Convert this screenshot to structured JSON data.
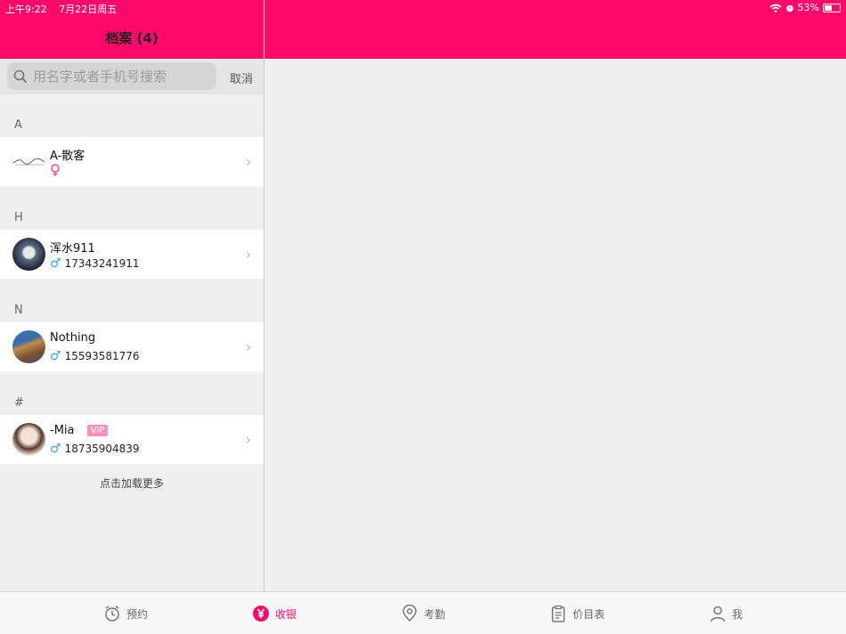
{
  "status_bar": {
    "time": "上午9:22",
    "date": "7月22日周五",
    "battery": "53%",
    "battery_level": 0.53
  },
  "header": {
    "title": "档案 (4)"
  },
  "search": {
    "placeholder": "用名字或者手机号搜索",
    "cancel_label": "取消"
  },
  "groups": [
    {
      "letter": "A",
      "items": [
        {
          "name": "A-散客",
          "phone": "",
          "gender": "female",
          "vip": false,
          "avatar": "logo"
        }
      ]
    },
    {
      "letter": "H",
      "items": [
        {
          "name": "浑水911",
          "phone": "17343241911",
          "gender": "male",
          "vip": false,
          "avatar": "photo"
        }
      ]
    },
    {
      "letter": "N",
      "items": [
        {
          "name": "Nothing",
          "phone": "15593581776",
          "gender": "male",
          "vip": false,
          "avatar": "photo"
        }
      ]
    },
    {
      "letter": "#",
      "items": [
        {
          "name": "-Mia",
          "phone": "18735904839",
          "gender": "male",
          "vip": true,
          "vip_label": "VIP",
          "avatar": "photo"
        }
      ]
    }
  ],
  "load_more_label": "点击加载更多",
  "tabs": [
    {
      "label": "预约",
      "icon": "alarm-clock-icon",
      "active": false
    },
    {
      "label": "收银",
      "icon": "yen-circle-icon",
      "active": true
    },
    {
      "label": "考勤",
      "icon": "location-pin-icon",
      "active": false
    },
    {
      "label": "价目表",
      "icon": "clipboard-icon",
      "active": false
    },
    {
      "label": "我",
      "icon": "person-icon",
      "active": false
    }
  ],
  "colors": {
    "accent": "#ff0a6b",
    "male": "#3aa6e2",
    "female": "#ff4f8a",
    "vip": "#ff8fb5"
  }
}
